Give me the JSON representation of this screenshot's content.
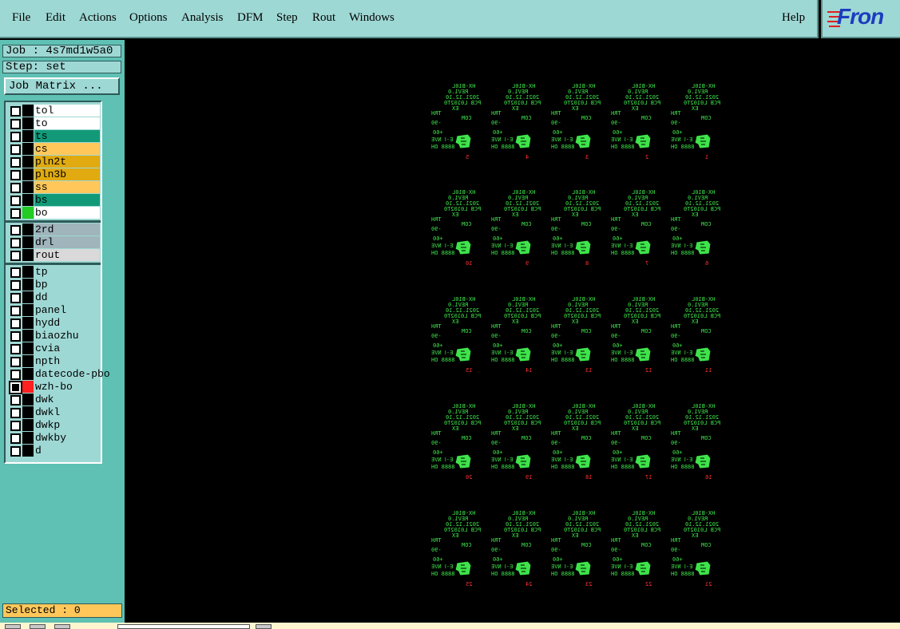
{
  "menu": {
    "file": "File",
    "edit": "Edit",
    "actions": "Actions",
    "options": "Options",
    "analysis": "Analysis",
    "dfm": "DFM",
    "step": "Step",
    "rout": "Rout",
    "windows": "Windows",
    "help": "Help"
  },
  "logo": {
    "text": "Fron"
  },
  "job": {
    "label": "Job : 4s7md1w5a0",
    "step": "Step: set",
    "matrix_button": "Job Matrix ..."
  },
  "layers": [
    {
      "name": "tol",
      "color": "#ffffff"
    },
    {
      "name": "to",
      "color": "#ffffff"
    },
    {
      "name": "ts",
      "color": "#129a78"
    },
    {
      "name": "cs",
      "color": "#ffc75a"
    },
    {
      "name": "pln2t",
      "color": "#e0aa10"
    },
    {
      "name": "pln3b",
      "color": "#e0aa10"
    },
    {
      "name": "ss",
      "color": "#ffc75a"
    },
    {
      "name": "bs",
      "color": "#129a78"
    },
    {
      "name": "bo",
      "color": "#ffffff"
    },
    {
      "name": "2rd",
      "color": "#9fb4bb"
    },
    {
      "name": "drl",
      "color": "#9fb4bb"
    },
    {
      "name": "rout",
      "color": "#d9d9d9"
    },
    {
      "name": "tp",
      "color": "#9ed8d4"
    },
    {
      "name": "bp",
      "color": "#9ed8d4"
    },
    {
      "name": "dd",
      "color": "#9ed8d4"
    },
    {
      "name": "panel",
      "color": "#9ed8d4"
    },
    {
      "name": "hydd",
      "color": "#9ed8d4"
    },
    {
      "name": "biaozhu",
      "color": "#9ed8d4"
    },
    {
      "name": "cvia",
      "color": "#9ed8d4"
    },
    {
      "name": "npth",
      "color": "#9ed8d4"
    },
    {
      "name": "datecode-pbo",
      "color": "#9ed8d4"
    },
    {
      "name": "wzh-bo",
      "color": "#9ed8d4"
    },
    {
      "name": "dwk",
      "color": "#9ed8d4"
    },
    {
      "name": "dwkl",
      "color": "#9ed8d4"
    },
    {
      "name": "dwkp",
      "color": "#9ed8d4"
    },
    {
      "name": "dwkby",
      "color": "#9ed8d4"
    },
    {
      "name": "d",
      "color": "#9ed8d4"
    }
  ],
  "status": {
    "selected": "Selected : 0"
  },
  "board_text": {
    "l1": "HX-B10L",
    "l2": "REV1.0",
    "l3": "2021.12.10",
    "l4": "PCB L0102T0",
    "l5": "EX",
    "l6": "TRH",
    "l7": "COM",
    "l8": "-90",
    "l9": "+60",
    "l10": "E-Ⅰ NVE",
    "l11": "8888 OH"
  },
  "boards": [
    "1",
    "2",
    "3",
    "4",
    "5",
    "6",
    "7",
    "8",
    "9",
    "10",
    "11",
    "12",
    "13",
    "14",
    "15",
    "16",
    "17",
    "18",
    "19",
    "20",
    "21",
    "22",
    "23",
    "24",
    "25"
  ]
}
